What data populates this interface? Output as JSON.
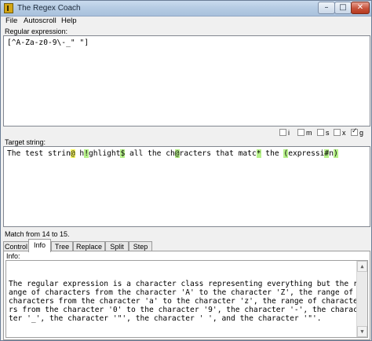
{
  "window": {
    "title": "The Regex Coach",
    "minimize_glyph": "–",
    "maximize_glyph": "□",
    "close_glyph": "✕"
  },
  "menu": {
    "items": [
      "File",
      "Autoscroll",
      "Help"
    ]
  },
  "regex": {
    "label": "Regular expression:",
    "value": "[^A-Za-z0-9\\-_\" \"]"
  },
  "options": [
    {
      "key": "i",
      "checked": false
    },
    {
      "key": "m",
      "checked": false
    },
    {
      "key": "s",
      "checked": false
    },
    {
      "key": "x",
      "checked": false
    },
    {
      "key": "g",
      "checked": true
    }
  ],
  "target": {
    "label": "Target string:",
    "segments": [
      {
        "text": "The test strin",
        "hl": ""
      },
      {
        "text": "@",
        "hl": "cur"
      },
      {
        "text": " h",
        "hl": ""
      },
      {
        "text": "!",
        "hl": "grp"
      },
      {
        "text": "ghlight",
        "hl": ""
      },
      {
        "text": "$",
        "hl": "grp"
      },
      {
        "text": " all the ch",
        "hl": ""
      },
      {
        "text": "@",
        "hl": "grp"
      },
      {
        "text": "racters that matc",
        "hl": ""
      },
      {
        "text": "*",
        "hl": "grp"
      },
      {
        "text": " the ",
        "hl": ""
      },
      {
        "text": "(",
        "hl": "grp"
      },
      {
        "text": "expressi",
        "hl": ""
      },
      {
        "text": "#",
        "hl": "grp"
      },
      {
        "text": "n",
        "hl": ""
      },
      {
        "text": ")",
        "hl": "grp"
      }
    ]
  },
  "status": {
    "match_text": "Match from 14 to 15."
  },
  "tabs": [
    "Control",
    "Info",
    "Tree",
    "Replace",
    "Split",
    "Step"
  ],
  "active_tab": "Info",
  "info": {
    "label": "Info:",
    "lines": [
      "The regular expression is a character class representing everything but the r",
      "ange of characters from the character 'A' to the character 'Z', the range of",
      "characters from the character 'a' to the character 'z', the range of characte",
      "rs from the character '0' to the character '9', the character '-', the charac",
      "ter '_', the character '\"', the character ' ', and the character '\"'."
    ]
  },
  "scroll": {
    "up_glyph": "▲",
    "down_glyph": "▼"
  },
  "colors": {
    "current_match": "#ffff66",
    "other_match": "#b7f28a"
  }
}
